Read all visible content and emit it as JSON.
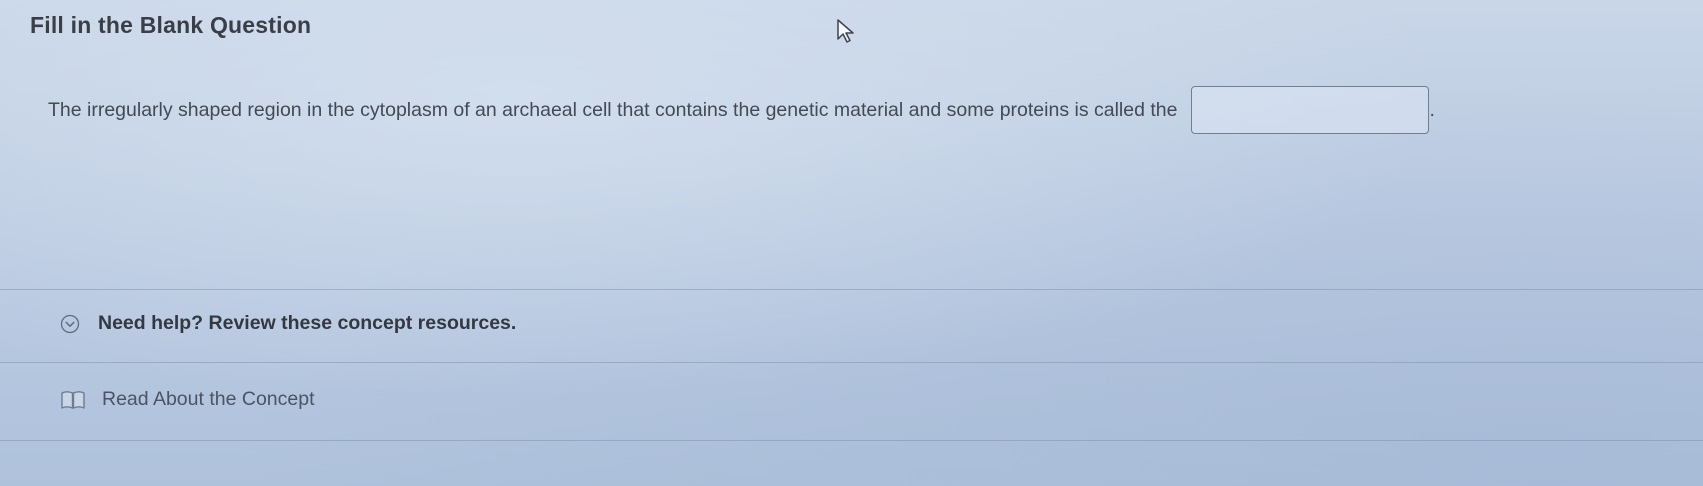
{
  "question": {
    "title": "Fill in the Blank Question",
    "prompt": "The irregularly shaped region in the cytoplasm of an archaeal cell that contains the genetic material and some proteins is called the",
    "trailing_punctuation": ".",
    "answer_value": ""
  },
  "help": {
    "toggle_icon": "chevron-down-circle-icon",
    "label": "Need help? Review these concept resources."
  },
  "resources": [
    {
      "icon": "book-icon",
      "label": "Read About the Concept"
    }
  ]
}
